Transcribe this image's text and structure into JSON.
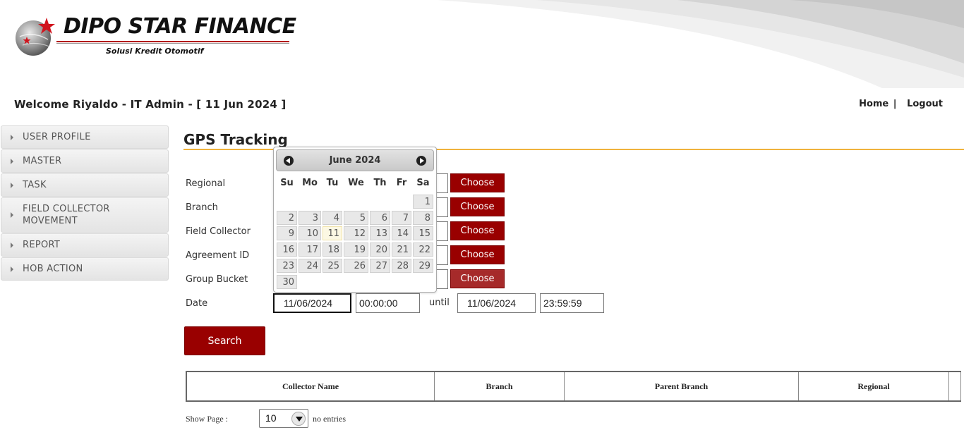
{
  "header": {
    "brand": "DIPO STAR FINANCE",
    "tagline": "Solusi Kredit Otomotif",
    "welcome": "Welcome Riyaldo - IT Admin - [ 11 Jun 2024 ]",
    "links": {
      "home": "Home",
      "separator": "|",
      "logout": "Logout"
    }
  },
  "sidebar": {
    "items": [
      {
        "label": "USER PROFILE"
      },
      {
        "label": "MASTER"
      },
      {
        "label": "TASK"
      },
      {
        "label": "FIELD COLLECTOR MOVEMENT"
      },
      {
        "label": "REPORT"
      },
      {
        "label": "HOB ACTION"
      }
    ]
  },
  "page": {
    "title": "GPS Tracking"
  },
  "form": {
    "fields": [
      {
        "label": "Regional",
        "value": "",
        "button": "Choose"
      },
      {
        "label": "Branch",
        "value": "",
        "button": "Choose"
      },
      {
        "label": "Field Collector",
        "value": "",
        "button": "Choose"
      },
      {
        "label": "Agreement ID",
        "value": "",
        "button": "Choose"
      },
      {
        "label": "Group Bucket",
        "value": "",
        "button": "Choose"
      }
    ],
    "date": {
      "label": "Date",
      "from_date": "11/06/2024",
      "from_time": "00:00:00",
      "until": "until",
      "to_date": "11/06/2024",
      "to_time": "23:59:59"
    },
    "search_button": "Search"
  },
  "table": {
    "columns": [
      "Collector Name",
      "Branch",
      "Parent Branch",
      "Regional"
    ]
  },
  "pagination": {
    "show_page_label": "Show Page :",
    "page_size": "10",
    "entries_label": "no entries"
  },
  "datepicker": {
    "title": "June 2024",
    "weekdays": [
      "Su",
      "Mo",
      "Tu",
      "We",
      "Th",
      "Fr",
      "Sa"
    ],
    "first_weekday_index": 6,
    "days_in_month": 30,
    "today": 11
  },
  "colors": {
    "brand_red": "#990000",
    "accent_orange": "#f0b23c"
  }
}
